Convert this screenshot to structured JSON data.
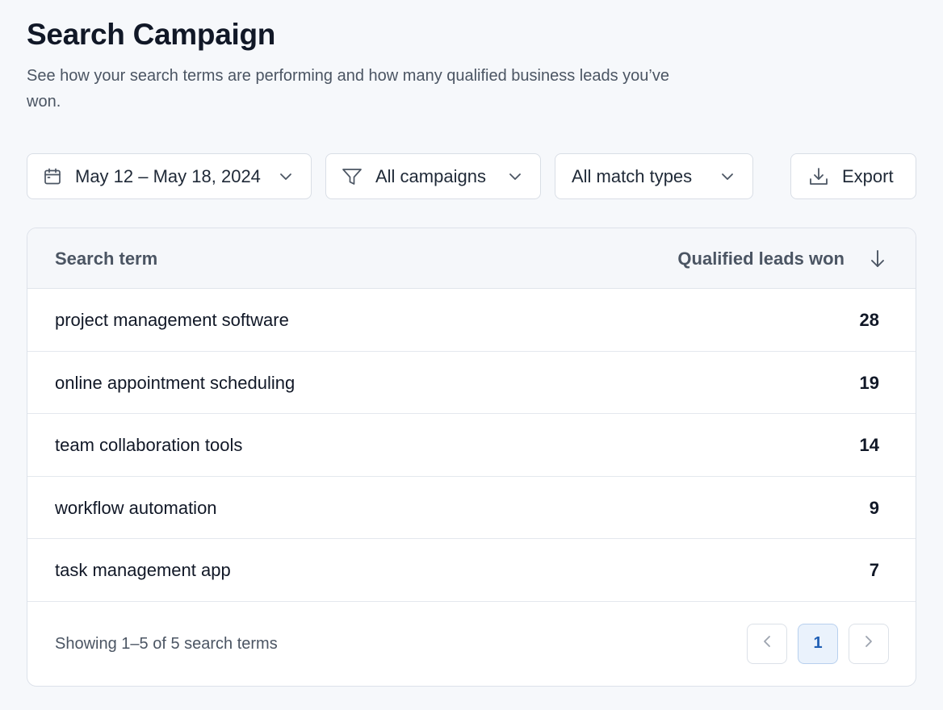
{
  "header": {
    "title": "Search Campaign",
    "subtitle": "See how your search terms are performing and how many qualified business leads you’ve won."
  },
  "filters": {
    "date_range": "May 12 – May 18, 2024",
    "campaign": "All campaigns",
    "match_type": "All match types",
    "export_label": "Export"
  },
  "table": {
    "columns": {
      "term": "Search term",
      "leads": "Qualified leads won"
    },
    "rows": [
      {
        "term": "project management software",
        "leads": "28"
      },
      {
        "term": "online appointment scheduling",
        "leads": "19"
      },
      {
        "term": "team collaboration tools",
        "leads": "14"
      },
      {
        "term": "workflow automation",
        "leads": "9"
      },
      {
        "term": "task management app",
        "leads": "7"
      }
    ],
    "footer_text": "Showing 1–5 of 5 search terms",
    "current_page": "1"
  },
  "icons": {
    "date": "calendar-icon",
    "campaign": "filter-icon",
    "dropdown": "chevron-down-icon",
    "export": "download-icon",
    "sort": "arrow-down-icon",
    "prev": "chevron-left-icon",
    "next": "chevron-right-icon"
  },
  "colors": {
    "background": "#f6f8fb",
    "accent": "#1f5fb5",
    "page_active_bg": "#eaf2fc"
  }
}
